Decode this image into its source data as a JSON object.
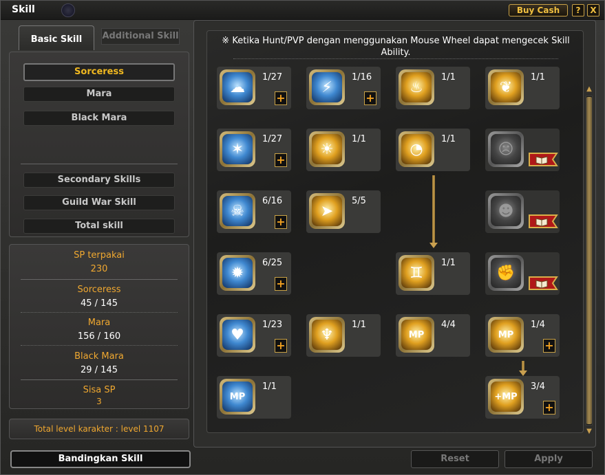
{
  "window": {
    "title": "Skill",
    "buy_cash": "Buy Cash",
    "help": "?",
    "close": "X"
  },
  "tabs": {
    "basic": "Basic Skill",
    "additional": "Additional Skill"
  },
  "classes": [
    "Sorceress",
    "Mara",
    "Black Mara"
  ],
  "categories": [
    "Secondary Skills",
    "Guild War Skill",
    "Total skill"
  ],
  "stats": {
    "sp_used_label": "SP terpakai",
    "sp_used": "230",
    "sorceress_label": "Sorceress",
    "sorceress": "45 / 145",
    "mara_label": "Mara",
    "mara": "156 / 160",
    "black_mara_label": "Black Mara",
    "black_mara": "29 / 145",
    "sisa_label": "Sisa SP",
    "sisa": "3"
  },
  "total_level": "Total level karakter : level 1107",
  "compare_button": "Bandingkan Skill",
  "notice": "※ Ketika Hunt/PVP dengan menggunakan Mouse Wheel dapat mengecek Skill Ability.",
  "skills": [
    {
      "level": "1/27",
      "style": "blue",
      "icon": "cloud-icon",
      "plus": true
    },
    {
      "level": "1/16",
      "style": "blue",
      "icon": "staff-icon",
      "plus": true
    },
    {
      "level": "1/1",
      "style": "gold",
      "icon": "cauldron-icon",
      "plus": false
    },
    {
      "level": "1/1",
      "style": "gold",
      "icon": "bird-icon",
      "plus": false
    },
    {
      "level": "1/27",
      "style": "blue",
      "icon": "star-burst-icon",
      "plus": true
    },
    {
      "level": "1/1",
      "style": "gold",
      "icon": "figure-aura-icon",
      "plus": false
    },
    {
      "level": "1/1",
      "style": "gold",
      "icon": "clock-icon",
      "plus": false
    },
    {
      "level": "",
      "style": "gray",
      "icon": "locked-face-icon",
      "plus": false,
      "book": true
    },
    {
      "level": "6/16",
      "style": "blue",
      "icon": "skull-icon",
      "plus": true
    },
    {
      "level": "5/5",
      "style": "gold",
      "icon": "running-man-icon",
      "plus": false
    },
    {
      "level": "",
      "style": "gray",
      "icon": "locked-head-icon",
      "plus": false,
      "book": true
    },
    {
      "level": "6/25",
      "style": "blue",
      "icon": "explosion-icon",
      "plus": true
    },
    {
      "level": "1/1",
      "style": "gold",
      "icon": "double-figure-icon",
      "plus": false
    },
    {
      "level": "",
      "style": "gray",
      "icon": "locked-fist-icon",
      "plus": false,
      "book": true
    },
    {
      "level": "1/23",
      "style": "blue",
      "icon": "heart-burst-icon",
      "plus": true
    },
    {
      "level": "1/1",
      "style": "gold",
      "icon": "cheering-man-icon",
      "plus": false
    },
    {
      "level": "4/4",
      "style": "gold",
      "icon": "mp-burst-icon",
      "plus": false
    },
    {
      "level": "1/4",
      "style": "gold",
      "icon": "mp-aura-icon",
      "plus": true
    },
    {
      "level": "1/1",
      "style": "blue",
      "icon": "mp-potion-icon",
      "plus": false
    },
    {
      "level": "3/4",
      "style": "gold",
      "icon": "mp-plus-icon",
      "plus": true
    }
  ],
  "buttons": {
    "reset": "Reset",
    "apply": "Apply"
  },
  "colors": {
    "accent": "#f0a830",
    "selected_class": "#f0b820",
    "frame_gold": "#c9a246"
  }
}
